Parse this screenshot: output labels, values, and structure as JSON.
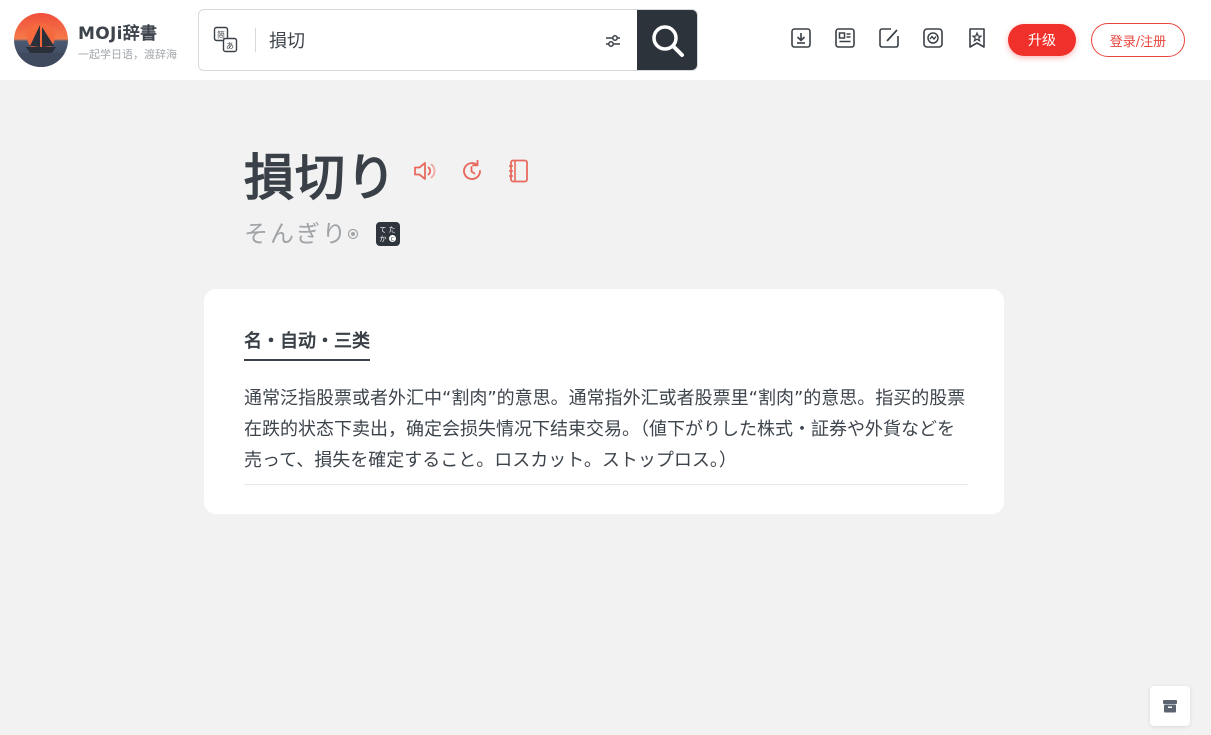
{
  "header": {
    "logo_title": "MOJi辞書",
    "logo_subtitle": "一起学日语，渡辞海",
    "search_value": "損切",
    "upgrade_label": "升级",
    "login_label": "登录/注册"
  },
  "entry": {
    "word": "損切り",
    "reading": "そんぎり",
    "part_of_speech": "名・自动・三类",
    "definition": "通常泛指股票或者外汇中“割肉”的意思。通常指外汇或者股票里“割肉”的意思。指买的股票在跌的状态下卖出，确定会损失情况下结束交易。（値下がりした株式・証券や外貨などを売って、損失を確定すること。ロスカット。ストップロス。）"
  },
  "colors": {
    "accent_red": "#f0312b",
    "icon_red": "#e86a5e",
    "dark": "#2c333b"
  },
  "icons": {
    "toolbar": [
      "download-icon",
      "card-icon",
      "edit-icon",
      "stats-icon",
      "bookmark-icon"
    ],
    "word_actions": [
      "speaker-icon",
      "refresh-icon",
      "notebook-icon"
    ]
  }
}
